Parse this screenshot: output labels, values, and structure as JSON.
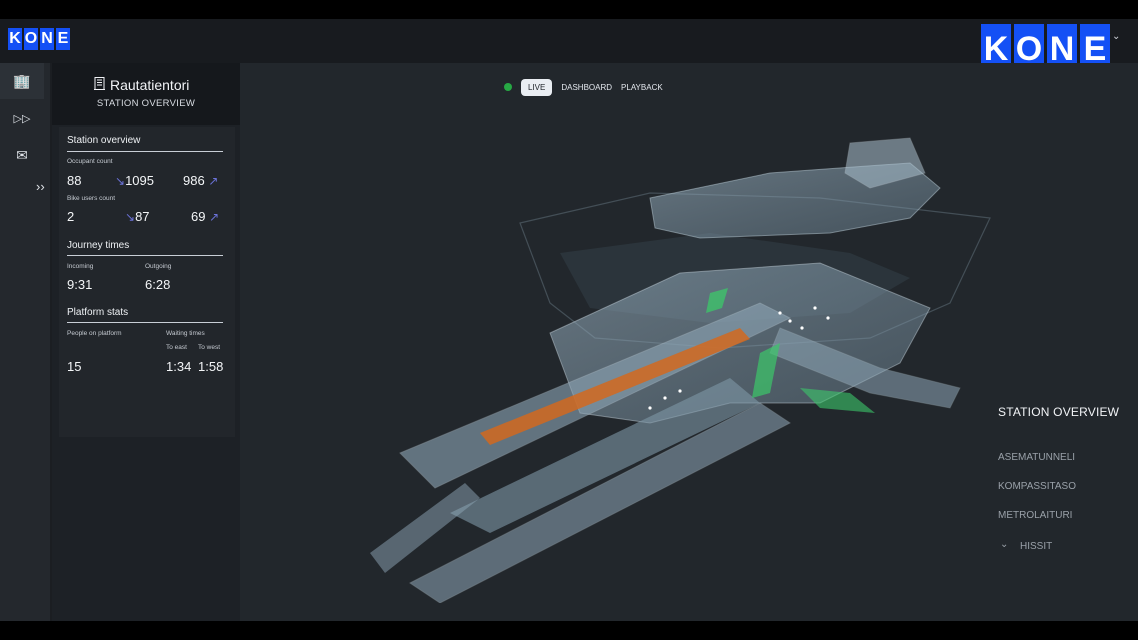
{
  "brand": {
    "logo_letters": [
      "K",
      "O",
      "N",
      "E"
    ],
    "accent_color": "#1450f5"
  },
  "user_menu": {
    "chevron_icon": "chevron-down-icon"
  },
  "icon_rail": {
    "items": [
      {
        "icon": "building-icon",
        "glyph": "🏢"
      },
      {
        "icon": "fast-forward-icon",
        "glyph": "▷▷"
      },
      {
        "icon": "mail-icon",
        "glyph": "✉"
      }
    ],
    "expand_glyph": "››"
  },
  "station": {
    "name": "Rautatientori",
    "subtitle": "STATION OVERVIEW",
    "icon": "building-icon"
  },
  "overview": {
    "title": "Station overview",
    "occupant": {
      "label": "Occupant count",
      "current": "88",
      "in": "1095",
      "out": "986"
    },
    "bike": {
      "label": "Bike users count",
      "current": "2",
      "in": "87",
      "out": "69"
    }
  },
  "journey": {
    "title": "Journey times",
    "incoming_label": "Incoming",
    "incoming": "9:31",
    "outgoing_label": "Outgoing",
    "outgoing": "6:28"
  },
  "platform": {
    "title": "Platform stats",
    "people_label": "People on platform",
    "people": "15",
    "waiting_label": "Waiting times",
    "east_label": "To east",
    "east": "1:34",
    "west_label": "To west",
    "west": "1:58"
  },
  "modes": {
    "live": "LIVE",
    "dashboard": "DASHBOARD",
    "playback": "PLAYBACK",
    "live_color": "#27a844"
  },
  "right_nav": {
    "title": "STATION OVERVIEW",
    "items": [
      "ASEMATUNNELI",
      "KOMPASSITASO",
      "METROLAITURI",
      "HISSIT"
    ]
  }
}
